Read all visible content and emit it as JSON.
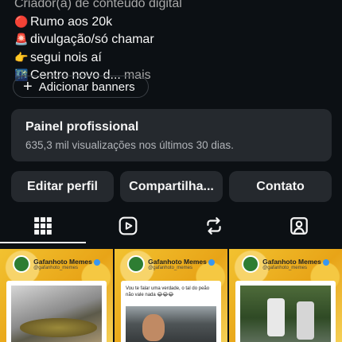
{
  "bio": {
    "lines": [
      {
        "emoji": "",
        "text": "Criador(a) de conteúdo digital"
      },
      {
        "emoji": "🔴",
        "text": "Rumo aos 20k"
      },
      {
        "emoji": "🚨",
        "text": "divulgação/só chamar"
      },
      {
        "emoji": "👉",
        "text": "segui nois aí"
      },
      {
        "emoji": "🌃",
        "text": "Centro novo d..."
      }
    ],
    "more_label": "mais"
  },
  "add_banners": {
    "label": "Adicionar banners",
    "icon": "plus-icon"
  },
  "professional_panel": {
    "title": "Painel profissional",
    "subtitle": "635,3 mil visualizações nos últimos 30 dias."
  },
  "actions": {
    "edit": "Editar perfil",
    "share": "Compartilha...",
    "contact": "Contato"
  },
  "tabs": [
    {
      "icon": "grid-icon",
      "active": true
    },
    {
      "icon": "reels-icon",
      "active": false
    },
    {
      "icon": "repost-icon",
      "active": false
    },
    {
      "icon": "tagged-icon",
      "active": false
    }
  ],
  "posts": [
    {
      "account": "Gafanhoto Memes",
      "handle": "@gafanhoto_memes",
      "caption": ""
    },
    {
      "account": "Gafanhoto Memes",
      "handle": "@gafanhoto_memes",
      "caption": "Vou te falar uma verdade, o tal do peão não vale nada 😂😂😂"
    },
    {
      "account": "Gafanhoto Memes",
      "handle": "@gafanhoto_memes",
      "caption": ""
    }
  ],
  "colors": {
    "background": "#0c1014",
    "panel": "#25292e",
    "text": "#f5f5f5",
    "muted": "#a8a8a8"
  }
}
